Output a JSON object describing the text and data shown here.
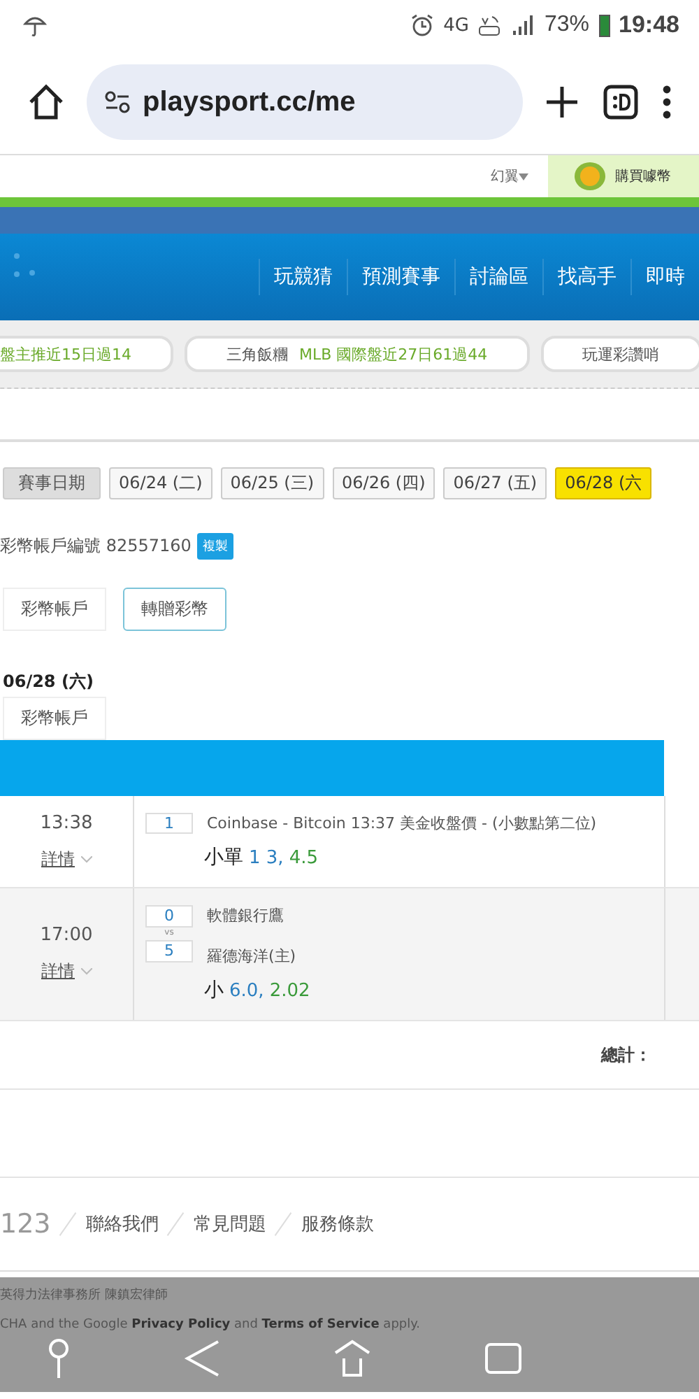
{
  "status_bar": {
    "network": "4G",
    "battery": "73%",
    "time": "19:48"
  },
  "browser": {
    "url": "playsport.cc/me"
  },
  "top_bar": {
    "dropdown": "幻翼",
    "buy_label": "購買噱幣"
  },
  "nav": {
    "items": [
      "玩競猜",
      "預測賽事",
      "討論區",
      "找高手",
      "即時"
    ]
  },
  "ticker": [
    {
      "parts": [
        {
          "text": "盤主推近15日過14",
          "kind": "highlight"
        }
      ]
    },
    {
      "parts": [
        {
          "text": "三角飯糰",
          "kind": "plain"
        },
        {
          "text": "MLB 國際盤近27日61過44",
          "kind": "highlight"
        }
      ]
    },
    {
      "parts": [
        {
          "text": "玩運彩讚哨",
          "kind": "plain"
        }
      ]
    }
  ],
  "dates": {
    "label": "賽事日期",
    "items": [
      {
        "label": "06/24 (二)",
        "selected": false
      },
      {
        "label": "06/25 (三)",
        "selected": false
      },
      {
        "label": "06/26 (四)",
        "selected": false
      },
      {
        "label": "06/27 (五)",
        "selected": false
      },
      {
        "label": "06/28 (六",
        "selected": true
      }
    ]
  },
  "account": {
    "label": "彩幣帳戶編號 82557160",
    "copy_button": "複製"
  },
  "tabs": [
    {
      "label": "彩幣帳戶",
      "selected": false
    },
    {
      "label": "轉贈彩幣",
      "selected": true
    }
  ],
  "date_heading": "06/28 (六)",
  "tab_repeat": "彩幣帳戶",
  "table": {
    "rows": [
      {
        "kind": "single",
        "time": "13:38",
        "details": "詳情",
        "number": "1",
        "title": "Coinbase - Bitcoin 13:37 美金收盤價 - (小數點第二位)",
        "pick": "小單",
        "line": "1 3,",
        "odds": "4.5"
      },
      {
        "kind": "match",
        "time": "17:00",
        "details": "詳情",
        "scores": [
          "0",
          "5"
        ],
        "vs": "vs",
        "teams": [
          "軟體銀行鷹",
          "羅德海洋(主)"
        ],
        "pick": "小",
        "line": "6.0,",
        "odds": "2.02"
      }
    ],
    "total_label": "總計："
  },
  "footer": {
    "links": [
      "123",
      "聯絡我們",
      "常見問題",
      "服務條款"
    ],
    "lawyer": "英得力法律事務所 陳鎮宏律師",
    "recaptcha": "CHA and the Google **Privacy Policy** and **Terms of Service** apply."
  }
}
